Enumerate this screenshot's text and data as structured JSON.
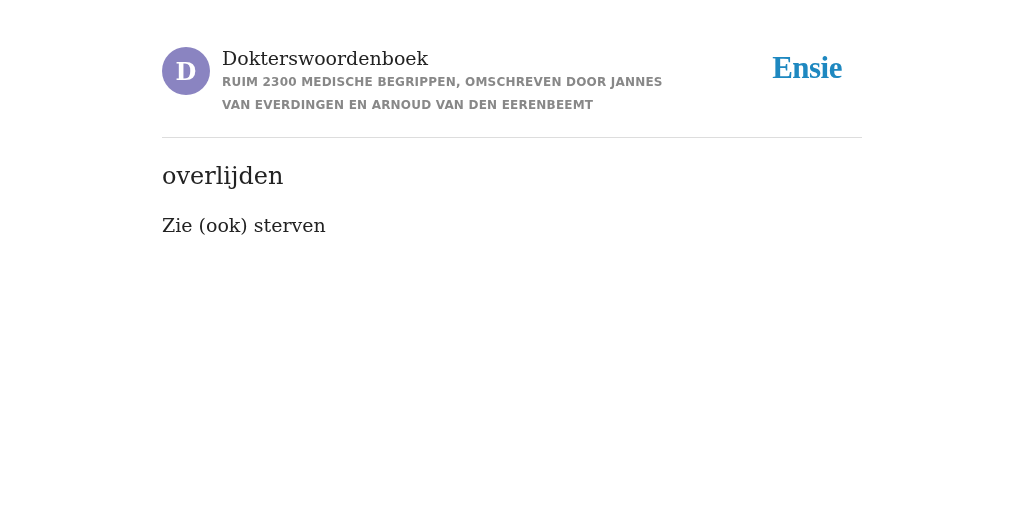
{
  "header": {
    "avatar_letter": "D",
    "title": "Dokterswoordenboek",
    "subtitle": "RUIM 2300 MEDISCHE BEGRIPPEN, OMSCHREVEN DOOR JANNES VAN EVERDINGEN EN ARNOUD VAN DEN EERENBEEMT",
    "logo": "Ensie"
  },
  "entry": {
    "term": "overlijden",
    "definition": "Zie (ook) sterven"
  }
}
